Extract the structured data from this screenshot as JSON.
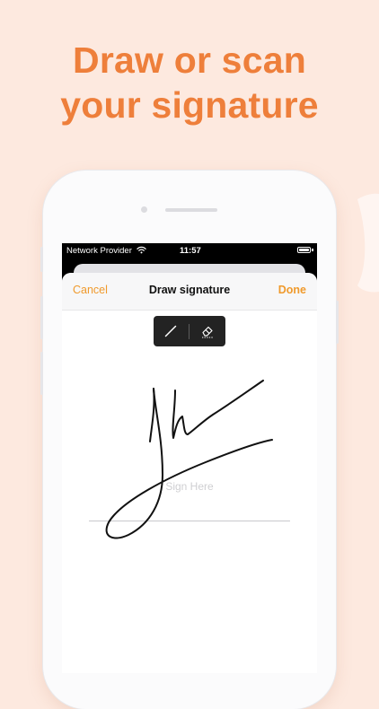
{
  "headline": {
    "line1": "Draw or scan",
    "line2": "your signature"
  },
  "colors": {
    "background": "#fde9df",
    "accent": "#ee7f3b",
    "nav_button": "#f09a2c",
    "toolbar": "#232323"
  },
  "status_bar": {
    "provider": "Network Provider",
    "time": "11:57",
    "wifi_icon": "wifi-icon",
    "battery_icon": "battery-icon"
  },
  "nav": {
    "cancel_label": "Cancel",
    "title": "Draw signature",
    "done_label": "Done"
  },
  "toolbar": {
    "tools": [
      {
        "name": "pen",
        "icon": "pen-icon",
        "selected": true
      },
      {
        "name": "eraser",
        "icon": "eraser-icon",
        "selected": false
      }
    ]
  },
  "signature_area": {
    "placeholder": "Sign Here",
    "has_signature": true
  }
}
